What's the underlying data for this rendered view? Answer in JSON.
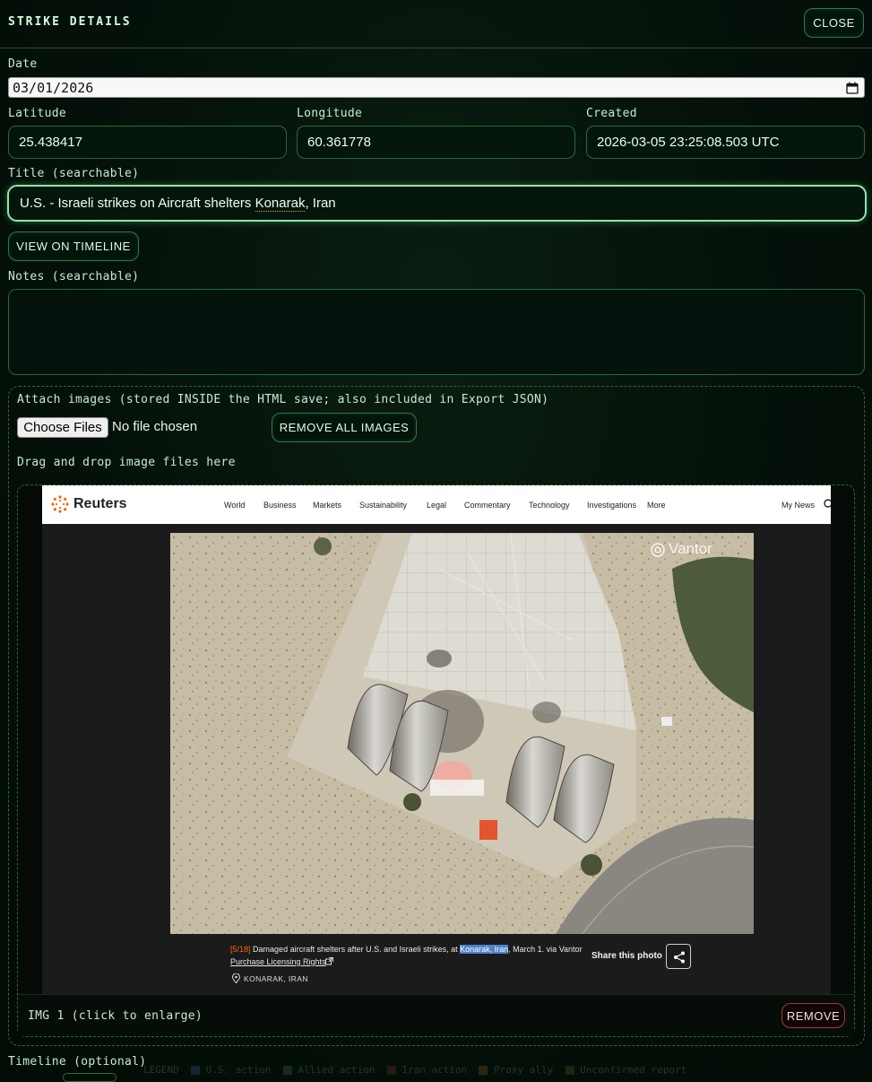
{
  "header": {
    "title": "STRIKE DETAILS",
    "close_label": "CLOSE"
  },
  "form": {
    "date_label": "Date",
    "date_value": "03/01/2026",
    "latitude_label": "Latitude",
    "latitude_value": "25.438417",
    "longitude_label": "Longitude",
    "longitude_value": "60.361778",
    "created_label": "Created",
    "created_value": "2026-03-05 23:25:08.503 UTC",
    "title_label": "Title (searchable)",
    "title_value_prefix": "U.S. - Israeli strikes on Aircraft shelters ",
    "title_value_highlight": "Konarak",
    "title_value_suffix": ", Iran",
    "view_timeline_label": "VIEW ON TIMELINE",
    "notes_label": "Notes (searchable)",
    "notes_value": ""
  },
  "attach": {
    "instructions": "Attach images (stored INSIDE the HTML save; also included in Export JSON)",
    "choose_files_label": "Choose Files",
    "no_file_text": "No file chosen",
    "remove_all_label": "REMOVE ALL IMAGES",
    "drag_drop_text": "Drag and drop image files here"
  },
  "image_card": {
    "caption": "IMG 1 (click to enlarge)",
    "remove_label": "REMOVE",
    "screenshot": {
      "brand": "Reuters",
      "nav": [
        "World",
        "Business",
        "Markets",
        "Sustainability",
        "Legal",
        "Commentary",
        "Technology",
        "Investigations",
        "More"
      ],
      "my_news": "My News",
      "watermark": "Vantor",
      "counter": "[5/18]",
      "caption_prefix": "Damaged aircraft shelters after U.S. and Israeli strikes, at ",
      "caption_highlight": "Konarak, Iran",
      "caption_suffix": ", March 1. via Vantor",
      "licensing": "Purchase Licensing Rights",
      "location": "KONARAK, IRAN",
      "share_label": "Share this photo"
    }
  },
  "timeline": {
    "label": "Timeline (optional)"
  },
  "legend_strip": {
    "label": "LEGEND",
    "items": [
      "U.S. action",
      "Allied action",
      "Iran action",
      "Proxy ally",
      "Unconfirmed report"
    ]
  },
  "colors": {
    "accent": "#8fe6a8",
    "danger": "#a03c3c",
    "highlight": "#4e82c8",
    "reuters_orange": "#fa6400"
  }
}
